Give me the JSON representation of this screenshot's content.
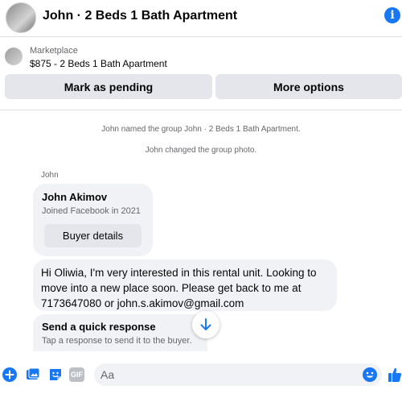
{
  "header": {
    "title": "John · 2 Beds 1 Bath Apartment",
    "info_icon": "info-icon",
    "info_glyph": "i"
  },
  "marketplace": {
    "label": "Marketplace",
    "listing": "$875 - 2 Beds 1 Bath Apartment",
    "pending_label": "Mark as pending",
    "more_label": "More options"
  },
  "chat": {
    "system_messages": [
      "John named the group John · 2 Beds 1 Bath Apartment.",
      "John changed the group photo."
    ],
    "sender": "John",
    "profile": {
      "name": "John Akimov",
      "joined": "Joined Facebook in 2021",
      "buyer_button": "Buyer details"
    },
    "message": "Hi Oliwia,  I'm very interested in this rental unit.  Looking to move into a new place soon. Please get back to me at 7173647080 or john.s.akimov@gmail.com",
    "quick_response": {
      "title": "Send a quick response",
      "subtitle": "Tap a response to send it to the buyer."
    }
  },
  "composer": {
    "placeholder": "Aa",
    "gif_label": "GIF"
  },
  "colors": {
    "accent": "#1877f2",
    "bubble": "#f0f2f5",
    "button": "#e4e6eb",
    "secondary_text": "#65676b"
  }
}
